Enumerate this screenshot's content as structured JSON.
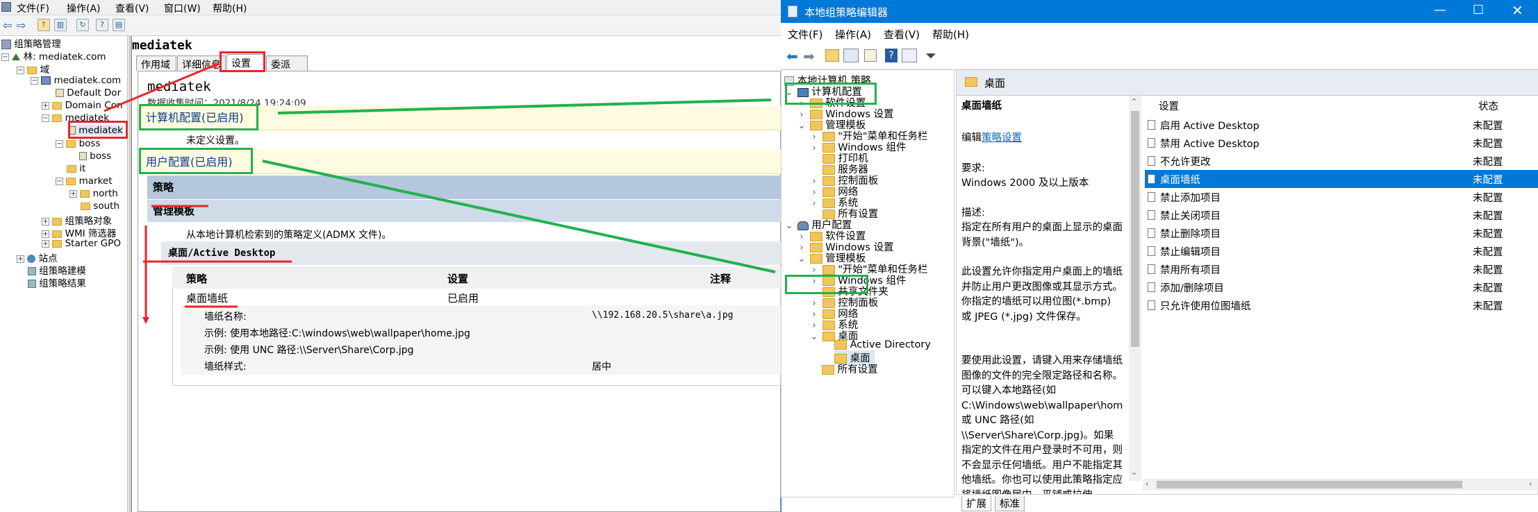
{
  "left_app": {
    "menu": [
      "文件(F)",
      "操作(A)",
      "查看(V)",
      "窗口(W)",
      "帮助(H)"
    ],
    "tree": {
      "root": "组策略管理",
      "forest": "林: mediatek.com",
      "domains": "域",
      "domain": "mediatek.com",
      "default_policy": "Default Dor",
      "domain_controllers": "Domain Con",
      "ou_mediatek": "mediatek",
      "gpo_mediatek": "mediatek",
      "ou_boss": "boss",
      "gpo_boss": "boss",
      "ou_it": "it",
      "ou_market": "market",
      "ou_north": "north",
      "ou_south": "south",
      "gp_objects": "组策略对象",
      "wmi_filters": "WMI 筛选器",
      "starter_gpo": "Starter GPO",
      "sites": "站点",
      "modeling": "组策略建模",
      "results": "组策略结果"
    },
    "report": {
      "title": "mediatek",
      "tabs": [
        "作用域",
        "详细信息",
        "设置",
        "委派"
      ],
      "heading": "mediatek",
      "collected": "数据收集时间：2021/8/24 19:24:09",
      "computer_config": "计算机配置(已启用)",
      "not_defined": "未定义设置。",
      "user_config": "用户配置(已启用)",
      "policies": "策略",
      "admin_templates": "管理模板",
      "admx_note": "从本地计算机检索到的策略定义(ADMX 文件)。",
      "desktop_path": "桌面/Active Desktop",
      "col_policy": "策略",
      "col_setting": "设置",
      "col_comment": "注释",
      "row_policy": "桌面墙纸",
      "row_state": "已启用",
      "wallpaper_name_label": "墙纸名称:",
      "wallpaper_name_value": "\\\\192.168.20.5\\share\\a.jpg",
      "example_local": "示例: 使用本地路径:C:\\windows\\web\\wallpaper\\home.jpg",
      "example_unc": "示例: 使用 UNC 路径:\\\\Server\\Share\\Corp.jpg",
      "wallpaper_style_label": "墙纸样式:",
      "wallpaper_style_value": "居中"
    }
  },
  "right_app": {
    "title": "本地组策略编辑器",
    "menu": [
      "文件(F)",
      "操作(A)",
      "查看(V)",
      "帮助(H)"
    ],
    "tree": {
      "root": "本地计算机 策略",
      "computer_config": "计算机配置",
      "c_software": "软件设置",
      "c_windows": "Windows 设置",
      "c_admin": "管理模板",
      "c_start": "\"开始\"菜单和任务栏",
      "c_wincomp": "Windows 组件",
      "c_printers": "打印机",
      "c_server": "服务器",
      "c_control": "控制面板",
      "c_network": "网络",
      "c_system": "系统",
      "c_all": "所有设置",
      "user_config": "用户配置",
      "u_software": "软件设置",
      "u_windows": "Windows 设置",
      "u_admin": "管理模板",
      "u_start": "\"开始\"菜单和任务栏",
      "u_wincomp": "Windows 组件",
      "u_shared": "共享文件夹",
      "u_control": "控制面板",
      "u_network": "网络",
      "u_system": "系统",
      "u_desktop": "桌面",
      "u_active": "Active Directory",
      "u_desktop2": "桌面",
      "u_all": "所有设置"
    },
    "header": "桌面",
    "desc": {
      "title": "桌面墙纸",
      "edit_prefix": "编辑",
      "edit_link": "策略设置",
      "req_label": "要求:",
      "req_value": "Windows 2000 及以上版本",
      "desc_label": "描述:",
      "desc_text": "指定在所有用户的桌面上显示的桌面背景(\"墙纸\")。",
      "para2": "此设置允许你指定用户桌面上的墙纸并防止用户更改图像或其显示方式。你指定的墙纸可以用位图(*.bmp) 或 JPEG (*.jpg) 文件保存。",
      "para3": "要使用此设置，请键入用来存储墙纸图像的文件的完全限定路径和名称。可以键入本地路径(如 C:\\Windows\\web\\wallpaper\\home.jpg)或 UNC 路径(如 \\\\Server\\Share\\Corp.jpg)。如果指定的文件在用户登录时不可用，则不会显示任何墙纸。用户不能指定其他墙纸。你也可以使用此策略指定应将墙纸图像居中、平铺或拉伸"
    },
    "columns": {
      "setting": "设置",
      "state": "状态"
    },
    "settings": [
      {
        "name": "启用 Active Desktop",
        "state": "未配置"
      },
      {
        "name": "禁用 Active Desktop",
        "state": "未配置"
      },
      {
        "name": "不允许更改",
        "state": "未配置"
      },
      {
        "name": "桌面墙纸",
        "state": "未配置"
      },
      {
        "name": "禁止添加项目",
        "state": "未配置"
      },
      {
        "name": "禁止关闭项目",
        "state": "未配置"
      },
      {
        "name": "禁止删除项目",
        "state": "未配置"
      },
      {
        "name": "禁止编辑项目",
        "state": "未配置"
      },
      {
        "name": "禁用所有项目",
        "state": "未配置"
      },
      {
        "name": "添加/删除项目",
        "state": "未配置"
      },
      {
        "name": "只允许使用位图墙纸",
        "state": "未配置"
      }
    ],
    "selected_index": 3,
    "bottom_tabs": [
      "扩展",
      "标准"
    ]
  },
  "colors": {
    "title_blue": "#0078d7",
    "annotation_red": "#e8262a",
    "annotation_green": "#22b14c"
  }
}
